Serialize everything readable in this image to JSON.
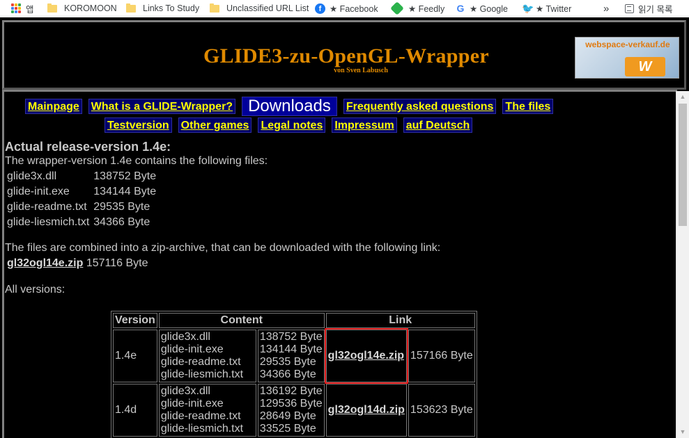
{
  "bookmarks": {
    "apps_label": "앱",
    "items": [
      {
        "label": "KOROMOON",
        "icon": "folder-icon"
      },
      {
        "label": "Links To Study",
        "icon": "folder-icon"
      },
      {
        "label": "Unclassified URL List",
        "icon": "folder-icon"
      },
      {
        "label": "★ Facebook",
        "icon": "facebook-icon"
      },
      {
        "label": "★ Feedly",
        "icon": "feedly-icon"
      },
      {
        "label": "★ Google",
        "icon": "google-icon"
      },
      {
        "label": "★ Twitter",
        "icon": "twitter-icon"
      }
    ],
    "overflow": "»",
    "reading_list": "읽기 목록"
  },
  "header": {
    "title": "GLIDE3-zu-OpenGL-Wrapper",
    "subtitle": "von Sven Labusch",
    "ad_text": "webspace-verkauf.de",
    "ad_logo": "W"
  },
  "nav": {
    "row1": [
      "Mainpage",
      "What is a GLIDE-Wrapper?",
      "Downloads",
      "Frequently asked questions",
      "The files"
    ],
    "row2": [
      "Testversion",
      "Other games",
      "Legal notes",
      "Impressum",
      "auf Deutsch"
    ],
    "current": "Downloads"
  },
  "release": {
    "heading": "Actual release-version 1.4e:",
    "intro": "The wrapper-version 1.4e contains the following files:",
    "files": [
      {
        "name": "glide3x.dll",
        "size": "138752 Byte"
      },
      {
        "name": "glide-init.exe",
        "size": "134144 Byte"
      },
      {
        "name": "glide-readme.txt",
        "size": "29535 Byte"
      },
      {
        "name": "glide-liesmich.txt",
        "size": "34366 Byte"
      }
    ],
    "zip_intro": "The files are combined into a zip-archive, that can be downloaded with the following link:",
    "zip_link": "gl32ogl14e.zip",
    "zip_size": "157116 Byte",
    "all_versions": "All versions:"
  },
  "versions_table": {
    "headers": [
      "Version",
      "Content",
      "Link"
    ],
    "rows": [
      {
        "version": "1.4e",
        "files": [
          "glide3x.dll",
          "glide-init.exe",
          "glide-readme.txt",
          "glide-liesmich.txt"
        ],
        "sizes": [
          "138752 Byte",
          "134144 Byte",
          "29535 Byte",
          "34366 Byte"
        ],
        "link": "gl32ogl14e.zip",
        "link_size": "157166 Byte"
      },
      {
        "version": "1.4d",
        "files": [
          "glide3x.dll",
          "glide-init.exe",
          "glide-readme.txt",
          "glide-liesmich.txt"
        ],
        "sizes": [
          "136192 Byte",
          "129536 Byte",
          "28649 Byte",
          "33525 Byte"
        ],
        "link": "gl32ogl14d.zip",
        "link_size": "153623 Byte"
      }
    ]
  }
}
